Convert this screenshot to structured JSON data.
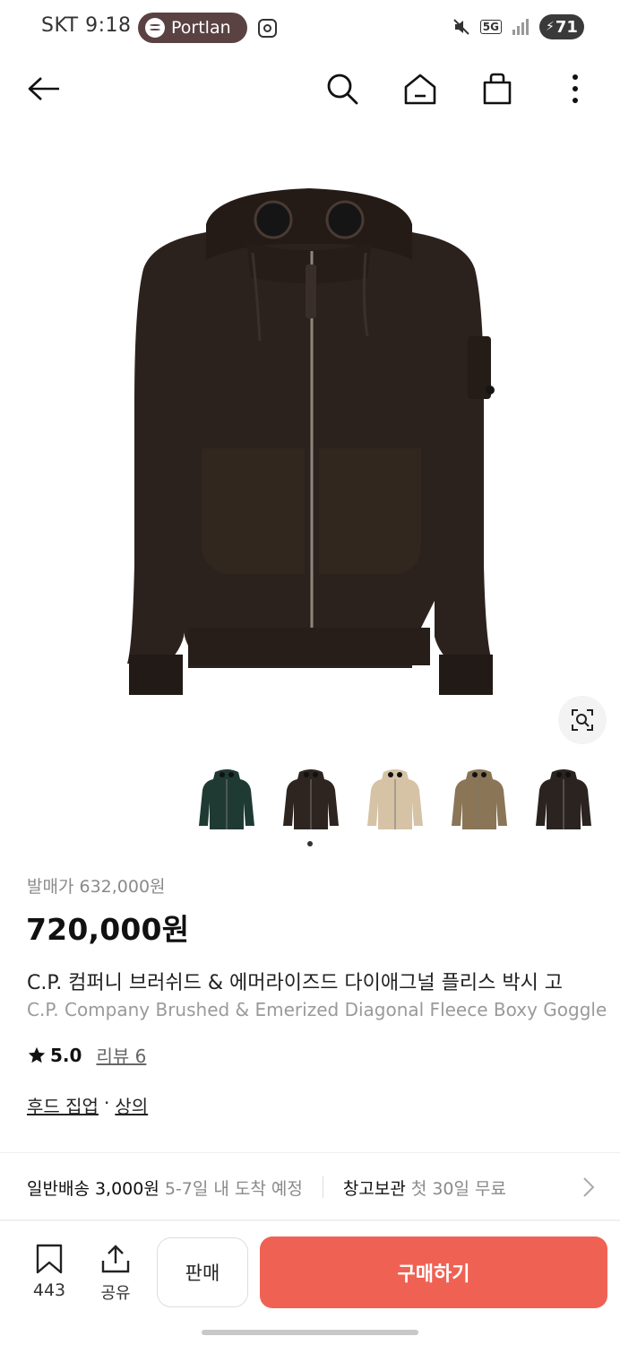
{
  "status_bar": {
    "carrier_time": "SKT 9:18",
    "media_pill": "Portlan",
    "network": "5G",
    "battery": "71"
  },
  "nav": {
    "icons": [
      "back-arrow-icon",
      "search-icon",
      "home-icon",
      "shopping-bag-icon",
      "more-vertical-icon"
    ]
  },
  "product": {
    "image_icon": "hooded-zip-jacket",
    "thumbnail_colors": [
      "#1f3a32",
      "#2e2420",
      "#d6c3a6",
      "#8a7556",
      "#2a2320"
    ],
    "selected_thumbnail": 1,
    "release_price": "발매가 632,000원",
    "price": "720,000원",
    "title_ko": "C.P. 컴퍼니 브러쉬드 & 에머라이즈드 다이애그널 플리스 박시 고",
    "title_en": "C.P. Company Brushed & Emerized Diagonal Fleece Boxy Goggle",
    "rating": "5.0",
    "review": "리뷰 6",
    "category1": "후드 집업",
    "category_sep": "·",
    "category2": "상의"
  },
  "shipping": {
    "standard_label": "일반배송 3,000원",
    "standard_eta": "5-7일 내 도착 예정",
    "storage_label": "창고보관",
    "storage_offer": "첫 30일 무료"
  },
  "bottom_bar": {
    "wish_count": "443",
    "share_label": "공유",
    "sell_label": "판매",
    "buy_label": "구매하기",
    "buy_color": "#ef6253"
  }
}
